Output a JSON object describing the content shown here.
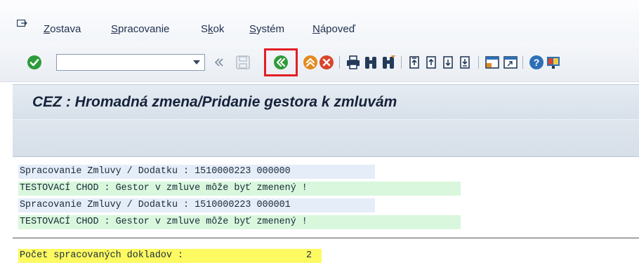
{
  "menu": {
    "items": [
      {
        "u": "Z",
        "rest": "ostava"
      },
      {
        "u": "S",
        "rest": "pracovanie"
      },
      {
        "pre": "S",
        "u": "k",
        "rest": "ok"
      },
      {
        "u": "S",
        "rest": "ystém"
      },
      {
        "u": "N",
        "rest": "ápoveď"
      }
    ]
  },
  "toolbar": {
    "command_value": "",
    "icons": [
      "enter-icon",
      "command-field",
      "back-chevron-icon",
      "save-icon",
      "back-icon",
      "exit-icon",
      "cancel-icon",
      "print-icon",
      "find-icon",
      "find-next-icon",
      "first-page-icon",
      "previous-page-icon",
      "next-page-icon",
      "last-page-icon",
      "create-session-icon",
      "shortcut-icon",
      "help-icon",
      "customize-icon"
    ],
    "highlighted": "back-icon"
  },
  "title": "CEZ : Hromadná zmena/Pridanie gestora k zmluvám",
  "output": {
    "lines": [
      {
        "text": "Spracovanie Zmluvy / Dodatku : 1510000223 000000",
        "style": "blue"
      },
      {
        "text": "TESTOVACÍ CHOD : Gestor v zmluve môže byť zmenený !",
        "style": "green"
      },
      {
        "text": "Spracovanie Zmluvy / Dodatku : 1510000223 000001",
        "style": "blue"
      },
      {
        "text": "TESTOVACÍ CHOD : Gestor v zmluve môže byť zmenený !",
        "style": "green"
      }
    ],
    "summary_label": "Počet spracovaných dokladov :",
    "summary_value": "2"
  },
  "colors": {
    "highlight": "#e31e24",
    "line_blue": "#e4edf8",
    "line_green": "#d9f7dc",
    "summary_yellow": "#fdfa62",
    "enter_green": "#2f9b3a",
    "back_orange": "#e38a1f",
    "cancel_red": "#d8452d"
  }
}
